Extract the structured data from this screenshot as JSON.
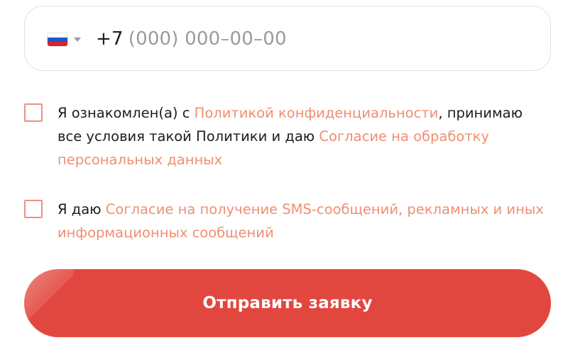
{
  "phone": {
    "country_icon": "russia-flag-icon",
    "flag_colors": [
      "#ffffff",
      "#1e57c8",
      "#d8232a"
    ],
    "prefix": "+7",
    "placeholder": "(000) 000–00–00"
  },
  "consents": [
    {
      "checked": false,
      "segments": [
        {
          "text": "Я ознакомлен(а) с ",
          "link": false
        },
        {
          "text": "Политикой конфиденциальности",
          "link": true
        },
        {
          "text": ", принимаю все условия такой Политики и даю ",
          "link": false
        },
        {
          "text": "Согласие на обработку персональных данных",
          "link": true
        }
      ]
    },
    {
      "checked": false,
      "segments": [
        {
          "text": "Я даю ",
          "link": false
        },
        {
          "text": "Согласие на получение SMS-сообщений, рекламных и иных информационных сообщений",
          "link": true
        }
      ]
    }
  ],
  "submit": {
    "label": "Отправить заявку",
    "color": "#e2473f"
  },
  "colors": {
    "link": "#ef8f72",
    "checkbox_border": "#ef8f84",
    "field_border": "#e3e3e6"
  }
}
